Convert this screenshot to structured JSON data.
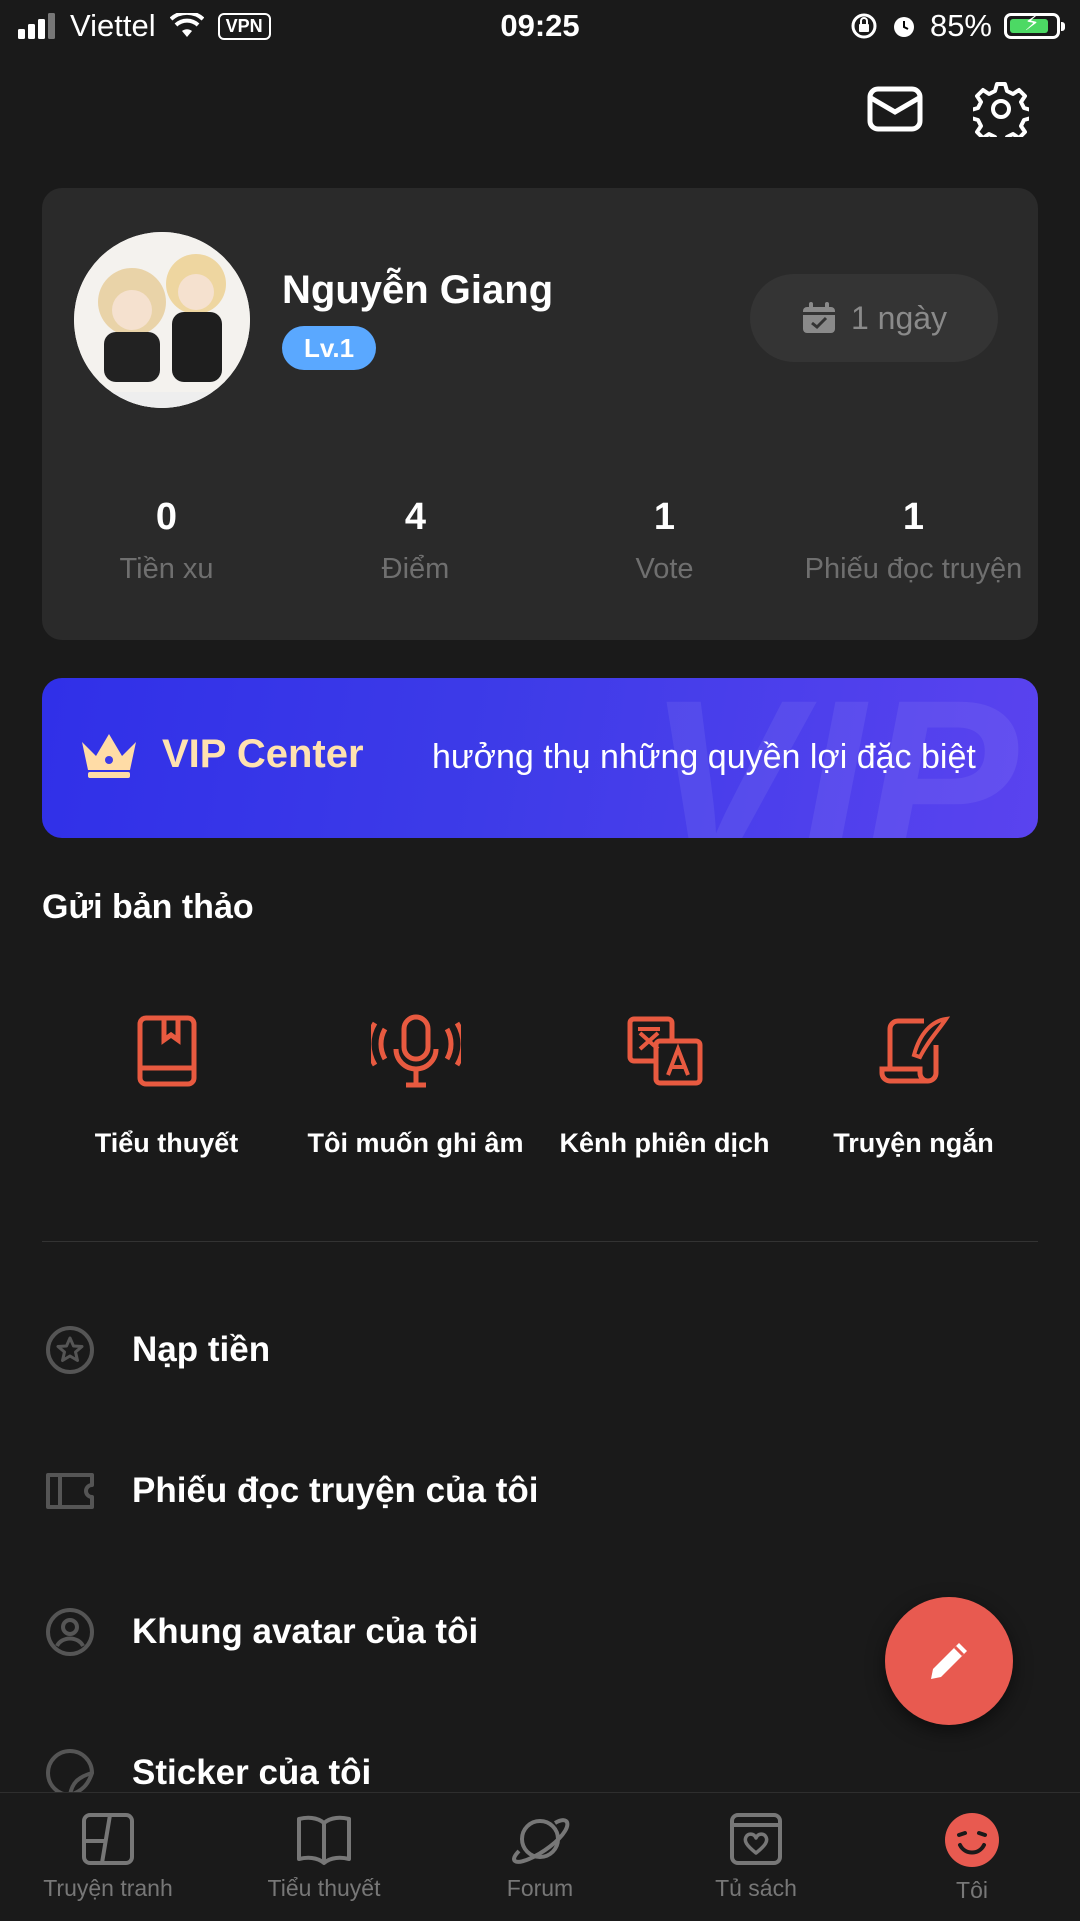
{
  "status_bar": {
    "carrier": "Viettel",
    "vpn": "VPN",
    "time": "09:25",
    "battery": "85%",
    "battery_level": 0.85
  },
  "profile": {
    "name": "Nguyễn Giang",
    "level": "Lv.1",
    "checkin": "1 ngày",
    "stats": [
      {
        "value": "0",
        "label": "Tiền xu"
      },
      {
        "value": "4",
        "label": "Điểm"
      },
      {
        "value": "1",
        "label": "Vote"
      },
      {
        "value": "1",
        "label": "Phiếu đọc truyện"
      }
    ]
  },
  "vip": {
    "title": "VIP Center",
    "description": "hưởng thụ những quyền lợi đặc biệt",
    "watermark": "VIP"
  },
  "drafts": {
    "title": "Gửi bản thảo",
    "items": [
      {
        "label": "Tiểu thuyết",
        "icon": "book-icon"
      },
      {
        "label": "Tôi muốn ghi âm",
        "icon": "microphone-icon"
      },
      {
        "label": "Kênh phiên dịch",
        "icon": "translate-icon"
      },
      {
        "label": "Truyện ngắn",
        "icon": "quill-icon"
      }
    ]
  },
  "menu": [
    {
      "label": "Nạp tiền",
      "icon": "star-coin-icon"
    },
    {
      "label": "Phiếu đọc truyện của tôi",
      "icon": "ticket-icon"
    },
    {
      "label": "Khung avatar của tôi",
      "icon": "avatar-frame-icon"
    },
    {
      "label": "Sticker của tôi",
      "icon": "sticker-icon"
    }
  ],
  "tabs": [
    {
      "label": "Truyện tranh",
      "icon": "comic-icon"
    },
    {
      "label": "Tiểu thuyết",
      "icon": "open-book-icon"
    },
    {
      "label": "Forum",
      "icon": "planet-icon"
    },
    {
      "label": "Tủ sách",
      "icon": "bookshelf-heart-icon"
    },
    {
      "label": "Tôi",
      "icon": "smile-face-icon"
    }
  ],
  "colors": {
    "accent": "#e85a50",
    "background": "#1a1a1a",
    "card": "#2a2a2a",
    "level_badge": "#5aa8ff",
    "vip": "#3a39e8"
  }
}
